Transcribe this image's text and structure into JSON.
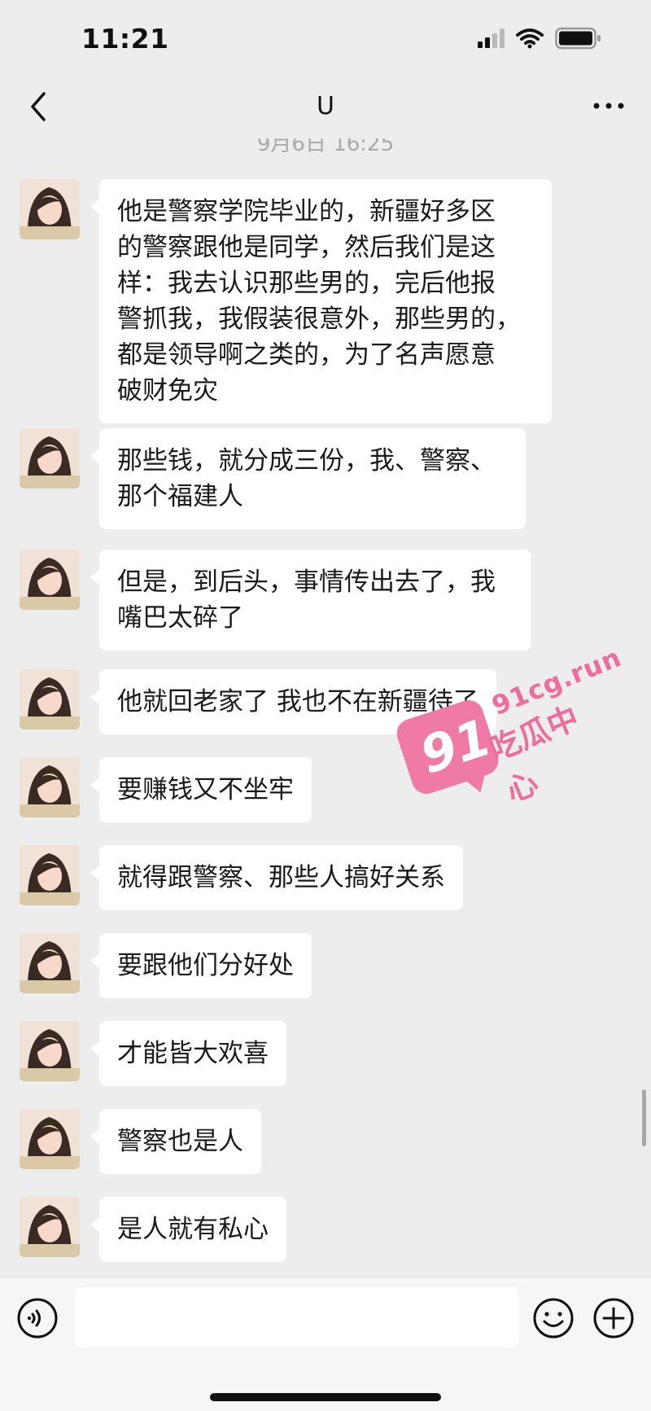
{
  "status_bar": {
    "time": "11:21"
  },
  "nav": {
    "title": "U"
  },
  "chat": {
    "timestamp": "9月6日 16:25",
    "messages": [
      {
        "text": "他是警察学院毕业的，新疆好多区\n的警察跟他是同学，然后我们是这\n样：我去认识那些男的，完后他报\n警抓我，我假装很意外，那些男的，\n都是领导啊之类的，为了名声愿意\n破财免灾"
      },
      {
        "text": "那些钱，就分成三份，我、警察、\n那个福建人"
      },
      {
        "text": "但是，到后头，事情传出去了，我\n嘴巴太碎了"
      },
      {
        "text": "他就回老家了 我也不在新疆待了"
      },
      {
        "text": "要赚钱又不坐牢"
      },
      {
        "text": "就得跟警察、那些人搞好关系"
      },
      {
        "text": "要跟他们分好处"
      },
      {
        "text": "才能皆大欢喜"
      },
      {
        "text": "警察也是人"
      },
      {
        "text": "是人就有私心"
      }
    ]
  },
  "watermark": {
    "number": "91",
    "url": "91cg.run",
    "name": "吃瓜中心"
  },
  "input": {
    "value": ""
  },
  "icons": {
    "back": "chevron-left-icon",
    "more": "more-dots-icon",
    "voice": "voice-icon",
    "emoji": "emoji-icon",
    "plus": "plus-icon"
  },
  "colors": {
    "background": "#ededed",
    "bubble": "#ffffff",
    "watermark": "#ee6d9d"
  }
}
